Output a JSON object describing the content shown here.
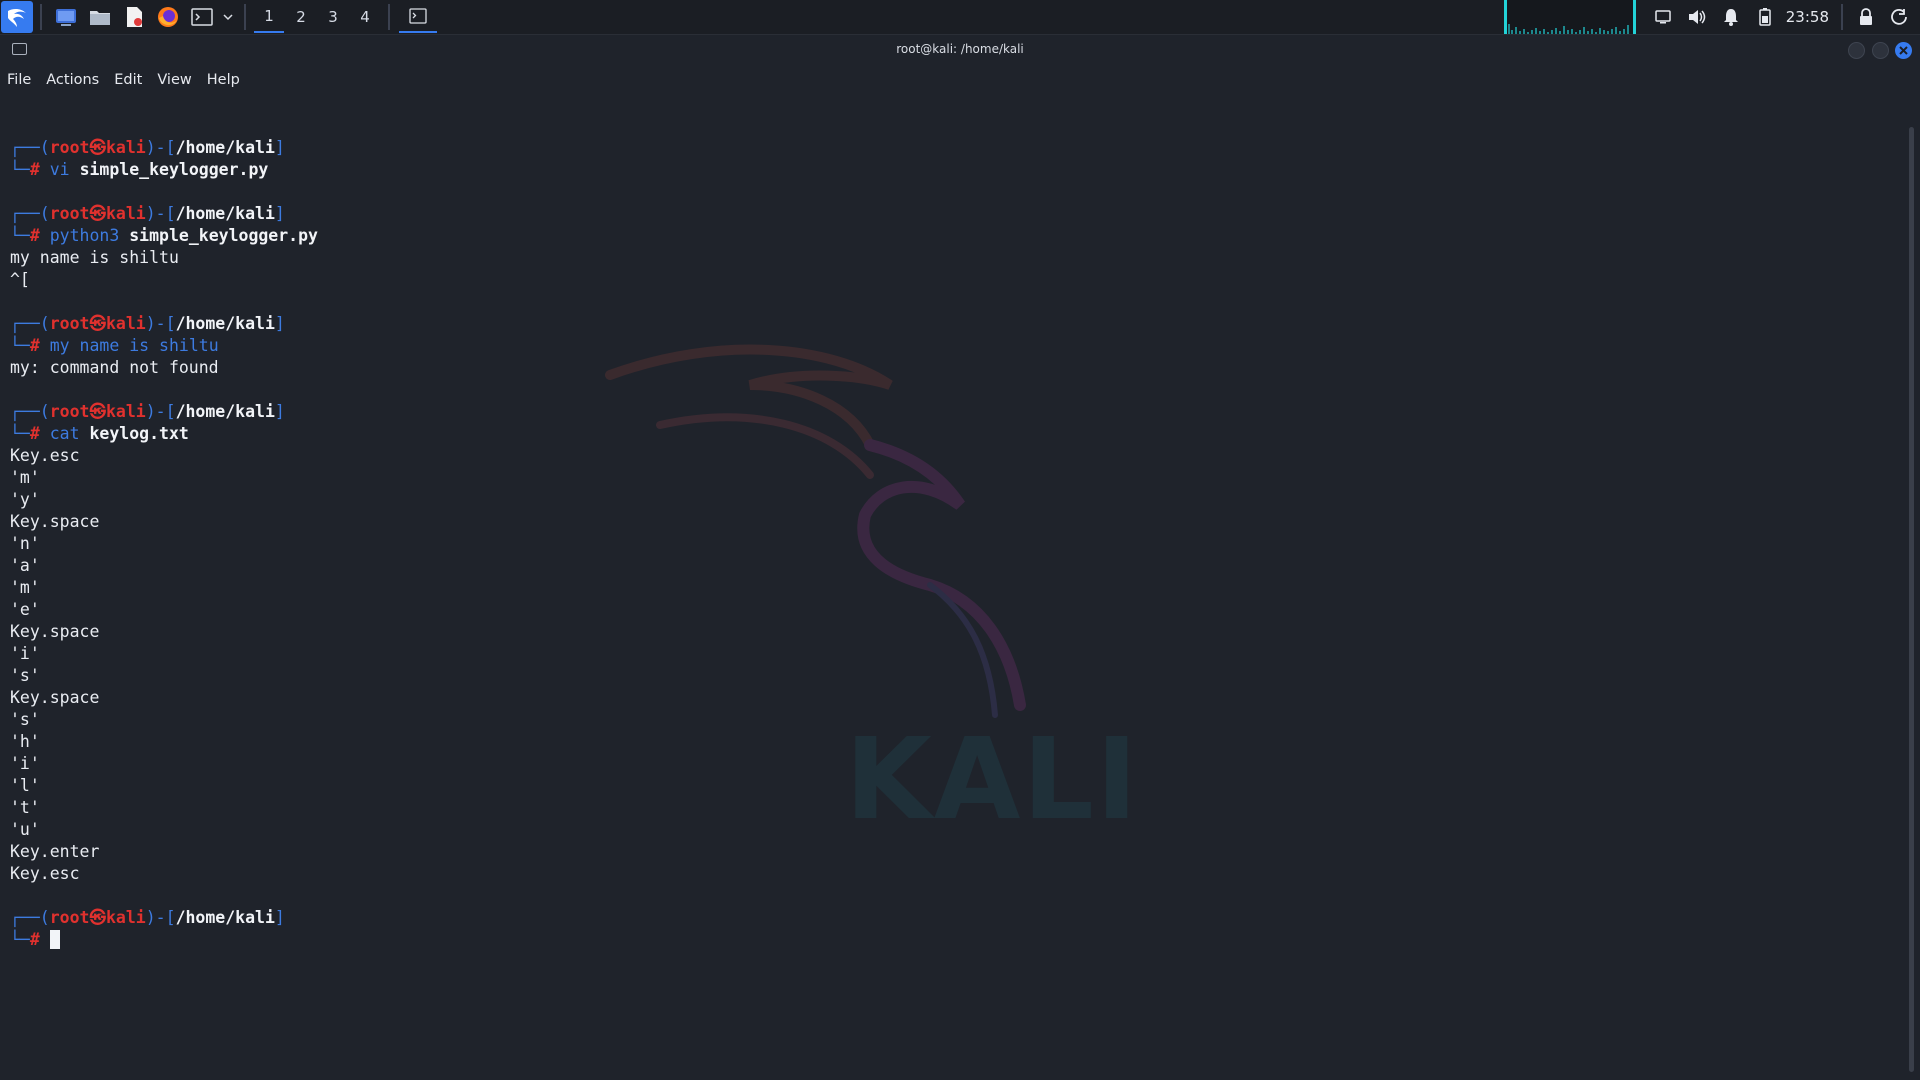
{
  "taskbar": {
    "workspaces": [
      "1",
      "2",
      "3",
      "4"
    ],
    "active_workspace": "1",
    "clock": "23:58",
    "launchers": [
      "desktop-icon",
      "file-manager-icon",
      "text-editor-icon",
      "firefox-icon",
      "terminal-icon"
    ],
    "tray": [
      "display-icon",
      "volume-icon",
      "notification-bell-icon",
      "battery-icon",
      "lock-icon",
      "power-icon"
    ],
    "colors": {
      "accent": "#367bf0",
      "cpu_graph": "#23d3d8"
    }
  },
  "window": {
    "title": "root@kali: /home/kali",
    "menu": [
      "File",
      "Actions",
      "Edit",
      "View",
      "Help"
    ]
  },
  "terminal": {
    "prompt": {
      "open": "┌──(",
      "user": "root",
      "at": "㉿",
      "host": "kali",
      "mid": ")-[",
      "path": "/home/kali",
      "close": "]",
      "second": "└─",
      "hash": "#"
    },
    "sessions": [
      {
        "cmd": "vi",
        "arg": "simple_keylogger.py",
        "output": []
      },
      {
        "cmd": "python3",
        "arg": "simple_keylogger.py",
        "output": [
          "my name is shiltu",
          "^["
        ]
      },
      {
        "cmd": "my name is shiltu",
        "arg": "",
        "output": [
          "my: command not found"
        ]
      },
      {
        "cmd": "cat",
        "arg": "keylog.txt",
        "output": [
          "Key.esc",
          "'m'",
          "'y'",
          "Key.space",
          "'n'",
          "'a'",
          "'m'",
          "'e'",
          "Key.space",
          "'i'",
          "'s'",
          "Key.space",
          "'s'",
          "'h'",
          "'i'",
          "'l'",
          "'t'",
          "'u'",
          "Key.enter",
          "Key.esc"
        ]
      }
    ],
    "watermark": "KALI",
    "colors": {
      "prompt_blue": "#3d7be0",
      "prompt_red": "#e0312e",
      "text": "#e9ecf2"
    }
  }
}
